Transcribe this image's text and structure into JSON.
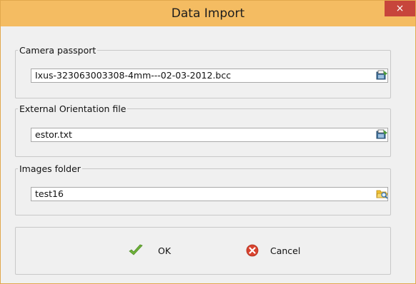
{
  "window": {
    "title": "Data Import",
    "close_glyph": "×"
  },
  "camera_passport": {
    "legend": "Camera passport",
    "value": "Ixus-323063003308-4mm---02-03-2012.bcc",
    "browse_icon": "open-file-icon"
  },
  "external_orientation": {
    "legend": "External Orientation file",
    "value": "estor.txt",
    "browse_icon": "open-file-icon"
  },
  "images_folder": {
    "legend": "Images folder",
    "value": "test16",
    "browse_icon": "open-folder-icon"
  },
  "buttons": {
    "ok_label": "OK",
    "cancel_label": "Cancel"
  },
  "colors": {
    "titlebar": "#f4bc62",
    "close_button": "#c7453b",
    "ok_check": "#6fb33a",
    "cancel_x": "#d9432f"
  }
}
